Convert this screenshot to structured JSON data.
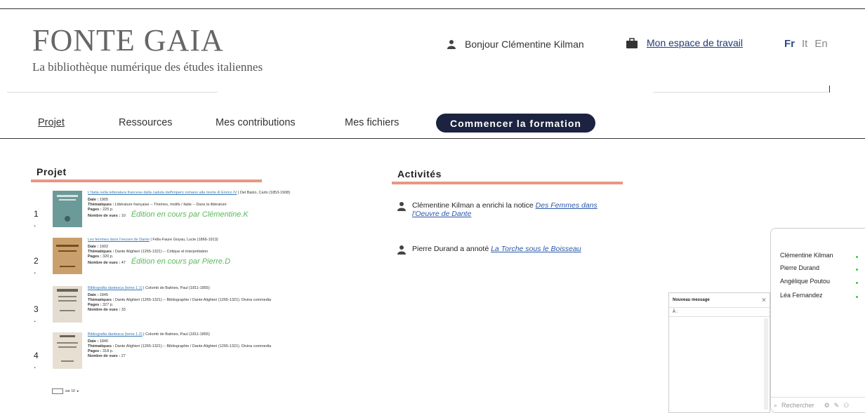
{
  "header": {
    "logo_title": "FONTE GAIA",
    "logo_subtitle": "La bibliothèque numérique des études italiennes",
    "greeting": "Bonjour Clémentine Kilman",
    "workspace": "Mon espace de travail",
    "languages": [
      "Fr",
      "It",
      "En"
    ]
  },
  "nav": {
    "items": [
      "Projet",
      "Ressources",
      "Mes contributions",
      "Mes fichiers"
    ],
    "cta": "Commencer la formation"
  },
  "projet": {
    "heading": "Projet",
    "entries": [
      {
        "num": "1 .",
        "title": "L'Italia nella letteratura francese dalla caduta dell'impero romano alla morte di Enrico IV",
        "author": "Del Balzo, Carlo (1853-1908)",
        "date": "1905",
        "themes": "Littérature française -- Thèmes, motifs / Italie -- Dans la littérature",
        "pages": "225 p.",
        "views": "10",
        "edit": "Édition en cours par Clémentine.K"
      },
      {
        "num": "2 .",
        "title": "Les femmes dans l'oeuvre de Dante",
        "author": "Félix-Faure Goyau, Lucie (1866-1913)",
        "date": "1902",
        "themes": "Dante Alighieri (1265-1321) -- Critique et interprétation",
        "pages": "320 p.",
        "views": "47",
        "edit": "Édition en cours par Pierre.D"
      },
      {
        "num": "3 .",
        "title": "Bibliografia dantesca (tome 1.1)",
        "author": "Colomb de Batines, Paul (1811-1855)",
        "date": "1845",
        "themes": "Dante Alighieri (1265-1321) -- Bibliographie / Dante Alighieri (1265-1321). Divina commedia",
        "pages": "327 p.",
        "views": "33",
        "edit": ""
      },
      {
        "num": "4 .",
        "title": "Bibliografia dantesca (tome 1.2)",
        "author": "Colomb de Batines, Paul (1811-1855)",
        "date": "1845",
        "themes": "Dante Alighieri (1265-1321) -- Bibliographie / Dante Alighieri (1265-1321). Divina commedia",
        "pages": "318 p.",
        "views": "27",
        "edit": ""
      }
    ],
    "labels": {
      "date": "Date : ",
      "themes": "Thématiques : ",
      "pages": "Pages : ",
      "views": "Nombre de vues : "
    },
    "pager": "sur 10"
  },
  "activites": {
    "heading": "Activités",
    "items": [
      {
        "text": "Clémentine Kilman a enrichi la notice ",
        "link": "Des Femmes dans l'Oeuvre de Dante"
      },
      {
        "text": "Pierre Durand a annoté ",
        "link": "La Torche sous le Boisseau"
      }
    ]
  },
  "message": {
    "title": "Nouveau message",
    "to": "À :"
  },
  "chat": {
    "users": [
      "Clémentine Kilman",
      "Pierre Durand",
      "Angélique Poutou",
      "Léa Fernandez"
    ],
    "search_placeholder": "Rechercher"
  },
  "colors": {
    "accent_bar": "#e99682",
    "cta_bg": "#1c2340",
    "link": "#2b58a7",
    "edit_green": "#5cb85c"
  }
}
